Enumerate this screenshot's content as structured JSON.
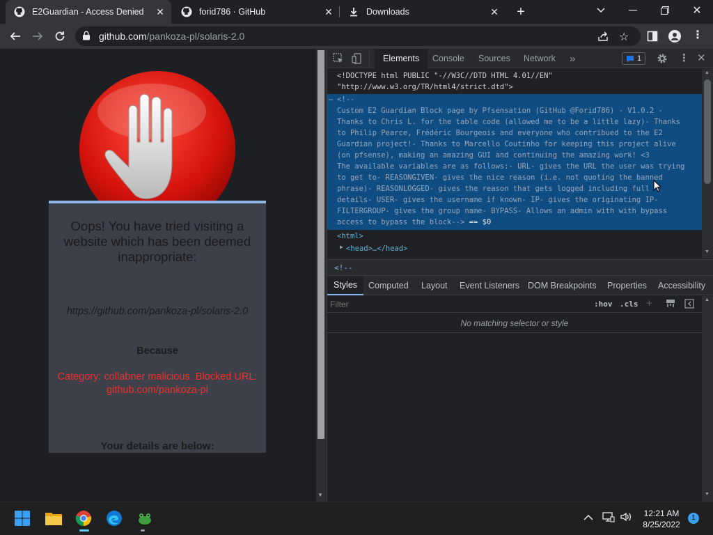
{
  "tabs": [
    {
      "label": "E2Guardian - Access Denied",
      "active": true
    },
    {
      "label": "forid786 · GitHub",
      "active": false
    },
    {
      "label": "Downloads",
      "active": false
    }
  ],
  "toolbar": {
    "url_host": "github.com",
    "url_path": "/pankoza-pl/solaris-2.0"
  },
  "block_page": {
    "headline": "Oops! You have tried visiting a website which has been deemed inappropriate:",
    "blocked_url": "https://github.com/pankoza-pl/solaris-2.0",
    "because": "Because",
    "reason": "Category: collabner malicious. Blocked URL: github.com/pankoza-pl",
    "details_heading": "Your details are below:"
  },
  "devtools": {
    "tabs": [
      "Elements",
      "Console",
      "Sources",
      "Network"
    ],
    "more_tabs": "»",
    "issues_count": "1",
    "code_lines": [
      "<!DOCTYPE html PUBLIC \"-//W3C//DTD HTML 4.01//EN\"",
      "\"http://www.w3.org/TR/html4/strict.dtd\">",
      "<!--",
      "Custom E2 Guardian Block page by Pfsensation (GitHub @Forid786) - V1.0.2 -",
      "Thanks to Chris L. for the table code (allowed me to be a little lazy)- Thanks",
      "to Philip Pearce, Frédéric Bourgeois and everyone who contribued to the E2",
      "Guardian project!- Thanks to Marcello Coutinho for keeping this project alive",
      "(on pfsense), making an amazing GUI and continuing the amazing work! <3",
      "The available variables are as follows:- URL- gives the URL the user was trying",
      "to get to- REASONGIVEN- gives the nice reason (i.e. not quoting the banned",
      "phrase)- REASONLOGGED- gives the reason that gets logged including full",
      "details- USER- gives the username if known- IP- gives the originating IP-",
      "FILTERGROUP- gives the group name- BYPASS- Allows an admin with with bypass",
      "access to bypass the block-->",
      "<html>",
      "<head>…</head>"
    ],
    "dollar_ref": "== $0",
    "breadcrumb": "<!--",
    "styles_tabs": [
      "Styles",
      "Computed",
      "Layout",
      "Event Listeners",
      "DOM Breakpoints",
      "Properties",
      "Accessibility"
    ],
    "filter_placeholder": "Filter",
    "hov": ":hov",
    "cls": ".cls",
    "no_match": "No matching selector or style"
  },
  "taskbar": {
    "time": "12:21 AM",
    "date": "8/25/2022",
    "notification_count": "1"
  },
  "colors": {
    "accent": "#8ab4f8",
    "reason_red": "#e8332e",
    "selection_blue": "#0e4c82"
  }
}
